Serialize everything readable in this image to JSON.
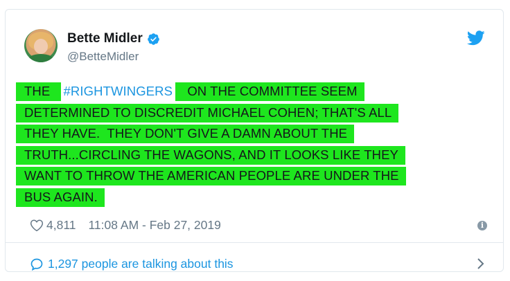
{
  "tweet": {
    "author_name": "Bette Midler",
    "author_handle": "@BetteMidler",
    "text_lines": [
      {
        "pre": "THE ",
        "hashtag": "#RIGHTWINGERS",
        "post": " ON THE COMMITTEE SEEM"
      },
      {
        "text": "DETERMINED TO DISCREDIT MICHAEL COHEN; THAT'S ALL"
      },
      {
        "text": "THEY HAVE.  THEY DON'T GIVE A DAMN ABOUT THE"
      },
      {
        "text": "TRUTH...CIRCLING THE WAGONS, AND IT LOOKS LIKE THEY"
      },
      {
        "text": "WANT TO THROW THE AMERICAN PEOPLE ARE UNDER THE"
      },
      {
        "text": "BUS AGAIN."
      }
    ],
    "likes": "4,811",
    "timestamp": "11:08 AM - Feb 27, 2019",
    "conversation": "1,297 people are talking about this"
  },
  "colors": {
    "highlight": "#1ee61e",
    "twitter_blue": "#1b95e0",
    "muted": "#657786"
  },
  "icons": {
    "verified": "verified-badge-icon",
    "twitter": "twitter-bird-icon",
    "like": "heart-icon",
    "info": "info-icon",
    "reply": "speech-bubble-icon",
    "more": "chevron-right-icon"
  }
}
